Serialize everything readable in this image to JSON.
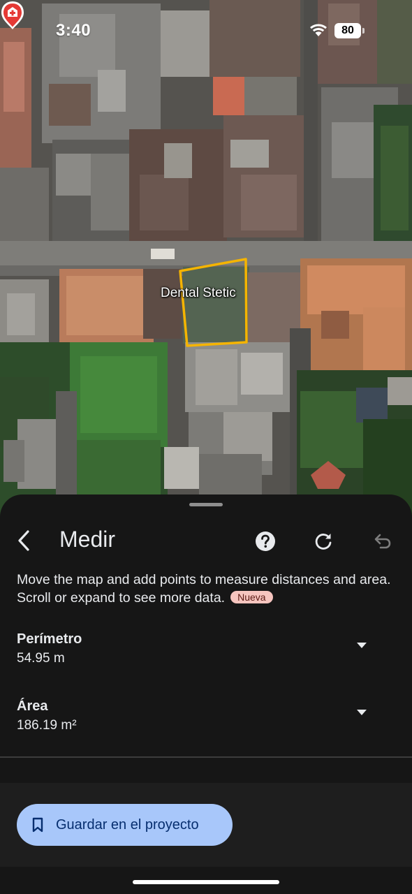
{
  "status_bar": {
    "time": "3:40",
    "battery": "80"
  },
  "map": {
    "place_label": "Dental Stetic",
    "measure_outline_color": "#f5b400",
    "pin_color": "#e53935"
  },
  "sheet": {
    "title": "Medir",
    "description": "Move the map and add points to measure distances and area. Scroll or expand to see more data.",
    "badge": "Nueva",
    "icons": {
      "back": "back-arrow-icon",
      "help": "help-icon",
      "reset": "refresh-icon",
      "undo": "undo-icon"
    },
    "perimeter": {
      "label": "Perímetro",
      "value": "54.95 m"
    },
    "area": {
      "label": "Área",
      "value": "186.19 m²"
    },
    "save_button": "Guardar en el proyecto"
  },
  "colors": {
    "sheet_bg": "#161616",
    "button_bg": "#a8c7fa",
    "button_text": "#062e6f",
    "badge_bg": "#f6c5bf"
  }
}
